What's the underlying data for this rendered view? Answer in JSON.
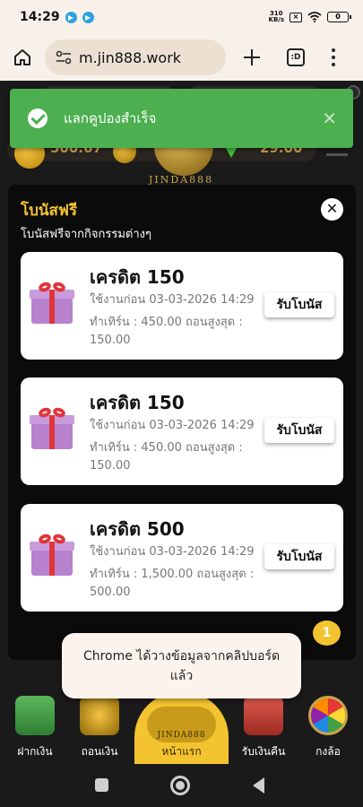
{
  "status_bar": {
    "time": "14:29",
    "net_speed_value": "310",
    "net_speed_unit": "KB/s",
    "battery": "0"
  },
  "browser": {
    "url": "m.jin888.work",
    "tabs_label": ":D"
  },
  "page_bg": {
    "balance_left": "500.67",
    "balance_right": "29.00",
    "logo_text": "JINDA888"
  },
  "toast": {
    "message": "แลกคูปองสำเร็จ",
    "close": "✕"
  },
  "modal": {
    "title": "โบนัสฟรี",
    "subtitle": "โบนัสฟรีจากกิจกรรมต่างๆ",
    "close": "✕",
    "cards": [
      {
        "title": "เครดิต 150",
        "use_before": "ใช้งานก่อน 03-03-2026 14:29",
        "turnover": "ทำเทิร์น : 450.00  ถอนสูงสุด :",
        "max_withdraw": "150.00",
        "button": "รับโบนัส"
      },
      {
        "title": "เครดิต 150",
        "use_before": "ใช้งานก่อน 03-03-2026 14:29",
        "turnover": "ทำเทิร์น : 450.00  ถอนสูงสุด :",
        "max_withdraw": "150.00",
        "button": "รับโบนัส"
      },
      {
        "title": "เครดิต 500",
        "use_before": "ใช้งานก่อน 03-03-2026 14:29",
        "turnover": "ทำเทิร์น : 1,500.00  ถอนสูงสุด :",
        "max_withdraw": "500.00",
        "button": "รับโบนัส"
      }
    ]
  },
  "badge": "1",
  "chrome_toast": "Chrome ได้วางข้อมูลจากคลิปบอร์ดแล้ว",
  "bottom_nav": {
    "deposit": "ฝากเงิน",
    "withdraw": "ถอนเงิน",
    "home": "หน้าแรก",
    "home_logo": "JINDA888",
    "cashback": "รับเงินคืน",
    "wheel": "กงล้อ"
  },
  "colors": {
    "accent_gold": "#f4c430",
    "toast_green": "#4caf50"
  }
}
